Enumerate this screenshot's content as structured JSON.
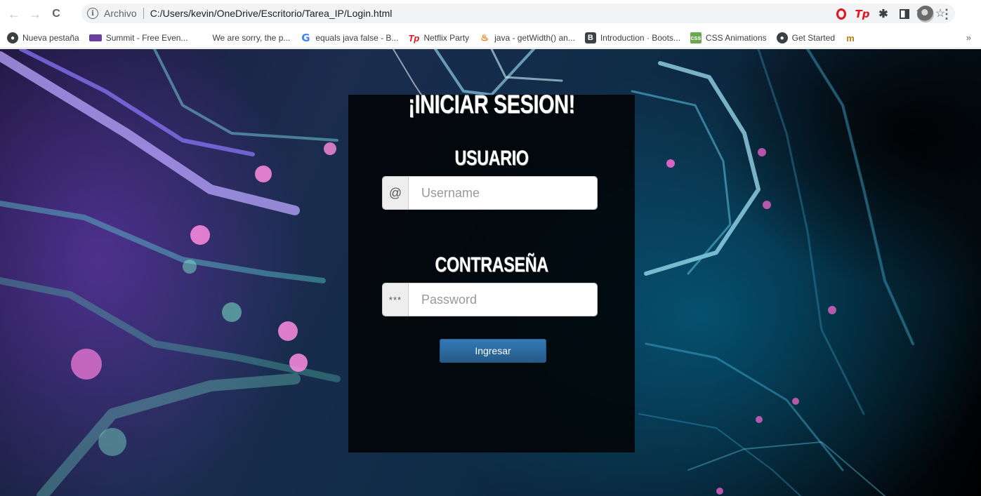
{
  "browser": {
    "back_icon": "←",
    "forward_icon": "→",
    "reload_icon": "C",
    "info_icon": "i",
    "scheme_label": "Archivo",
    "url": "C:/Users/kevin/OneDrive/Escritorio/Tarea_IP/Login.html",
    "share_icon": "⇪",
    "star_icon": "☆",
    "extensions": {
      "tp_label": "Tp",
      "puzzle_icon": "✱",
      "menu_icon": "⋮"
    }
  },
  "bookmarks": [
    {
      "icon": "globe",
      "glyph": "●",
      "label": "Nueva pestaña"
    },
    {
      "icon": "summit",
      "glyph": "",
      "label": "Summit - Free Even..."
    },
    {
      "icon": "microsoft",
      "glyph": "",
      "label": "We are sorry, the p..."
    },
    {
      "icon": "google",
      "glyph": "G",
      "label": "equals java false - B..."
    },
    {
      "icon": "teleparty",
      "glyph": "Tp",
      "label": "Netflix Party"
    },
    {
      "icon": "java",
      "glyph": "♨",
      "label": "java - getWidth() an..."
    },
    {
      "icon": "bootstrap",
      "glyph": "B",
      "label": "Introduction · Boots..."
    },
    {
      "icon": "css",
      "glyph": "css",
      "label": "CSS Animations"
    },
    {
      "icon": "globe",
      "glyph": "●",
      "label": "Get Started"
    },
    {
      "icon": "moodle",
      "glyph": "m",
      "label": ""
    }
  ],
  "bookmarks_more": "»",
  "login": {
    "title": "¡INICIAR SESION!",
    "user_label": "USUARIO",
    "user_addon": "@",
    "user_placeholder": "Username",
    "pass_label": "CONTRASEÑA",
    "pass_addon": "***",
    "pass_placeholder": "Password",
    "submit_label": "Ingresar"
  },
  "colors": {
    "button_primary": "#337ab7",
    "panel_bg": "#000000",
    "text_heading": "#ffffff"
  }
}
